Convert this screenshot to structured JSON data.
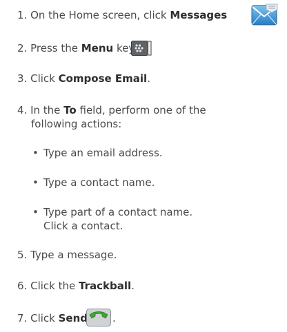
{
  "steps": [
    {
      "number": "1.",
      "pre": "On the Home screen, click ",
      "bold": "Messages",
      "post": ""
    },
    {
      "number": "2.",
      "pre": "Press the ",
      "bold": "Menu",
      "post": " key"
    },
    {
      "number": "3.",
      "pre": "Click ",
      "bold": "Compose Email",
      "post": "."
    },
    {
      "number": "4.",
      "pre": "In the ",
      "bold": "To",
      "post": " field, perform one of the",
      "line2": "following actions:"
    },
    {
      "number": "5.",
      "pre": "Type a message.",
      "bold": "",
      "post": ""
    },
    {
      "number": "6.",
      "pre": "Click the ",
      "bold": "Trackball",
      "post": "."
    },
    {
      "number": "7.",
      "pre": "Click ",
      "bold": "Send",
      "post": "."
    }
  ],
  "bullets": [
    {
      "text": "Type an email address."
    },
    {
      "text": "Type a contact name."
    },
    {
      "text": "Type part of a contact name.",
      "line2": "Click a contact."
    }
  ],
  "icons": {
    "messages": "envelope-icon",
    "menu": "blackberry-menu-key-icon",
    "send": "green-phone-send-icon"
  }
}
